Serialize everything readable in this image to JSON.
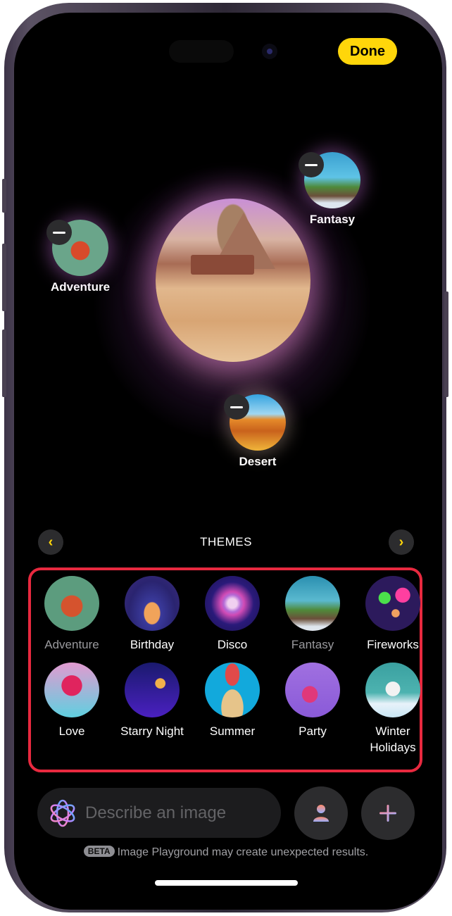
{
  "header": {
    "done_label": "Done"
  },
  "canvas": {
    "selected_concepts": [
      {
        "label": "Adventure"
      },
      {
        "label": "Fantasy"
      },
      {
        "label": "Desert"
      }
    ]
  },
  "themes_section": {
    "title": "THEMES",
    "prev_icon": "chevron-left-icon",
    "next_icon": "chevron-right-icon",
    "items": [
      {
        "label": "Adventure",
        "selected": true
      },
      {
        "label": "Birthday",
        "selected": false
      },
      {
        "label": "Disco",
        "selected": false
      },
      {
        "label": "Fantasy",
        "selected": true
      },
      {
        "label": "Fireworks",
        "selected": false
      },
      {
        "label": "Love",
        "selected": false
      },
      {
        "label": "Starry Night",
        "selected": false
      },
      {
        "label": "Summer",
        "selected": false
      },
      {
        "label": "Party",
        "selected": false
      },
      {
        "label": "Winter\nHolidays",
        "selected": false
      }
    ]
  },
  "prompt": {
    "placeholder": "Describe an image",
    "icon": "image-playground-icon",
    "person_button_icon": "person-icon",
    "add_button_icon": "plus-icon"
  },
  "footer": {
    "beta_badge": "BETA",
    "disclaimer": "Image Playground may create unexpected results."
  },
  "colors": {
    "accent": "#ffd60a",
    "highlight_border": "#e8293f",
    "background": "#000000"
  }
}
